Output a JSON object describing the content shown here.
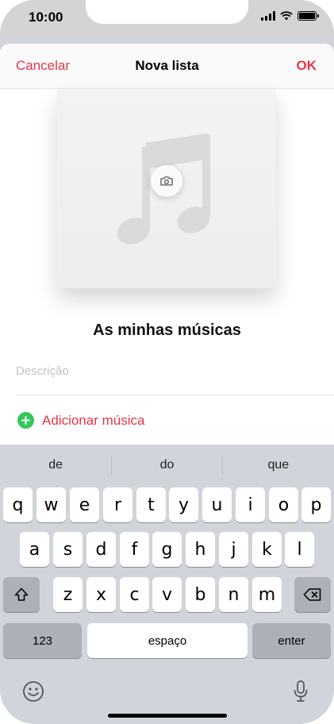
{
  "status_bar": {
    "time": "10:00"
  },
  "nav": {
    "cancel_label": "Cancelar",
    "title": "Nova lista",
    "ok_label": "OK"
  },
  "playlist": {
    "name": "As minhas músicas",
    "description_placeholder": "Descrição",
    "add_music_label": "Adicionar música"
  },
  "keyboard": {
    "suggestions": [
      "de",
      "do",
      "que"
    ],
    "row1": [
      "q",
      "w",
      "e",
      "r",
      "t",
      "y",
      "u",
      "i",
      "o",
      "p"
    ],
    "row2": [
      "a",
      "s",
      "d",
      "f",
      "g",
      "h",
      "j",
      "k",
      "l"
    ],
    "row3": [
      "z",
      "x",
      "c",
      "v",
      "b",
      "n",
      "m"
    ],
    "numbers_label": "123",
    "space_label": "espaço",
    "enter_label": "enter"
  },
  "colors": {
    "accent": "#e5364c",
    "add_green": "#34c759",
    "keyboard_bg": "#d1d4da"
  }
}
